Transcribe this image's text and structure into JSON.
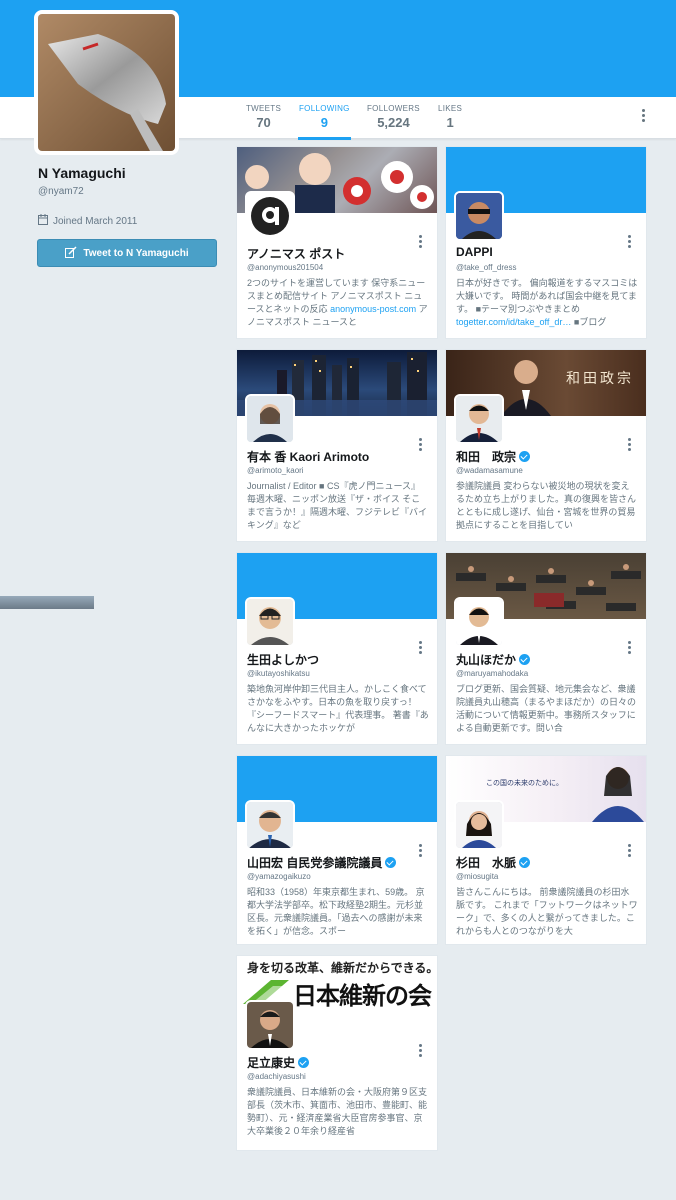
{
  "header": {
    "banner_color": "#1da1f2"
  },
  "nav": {
    "stats": [
      {
        "label": "TWEETS",
        "value": "70"
      },
      {
        "label": "FOLLOWING",
        "value": "9"
      },
      {
        "label": "FOLLOWERS",
        "value": "5,224"
      },
      {
        "label": "LIKES",
        "value": "1"
      }
    ],
    "active_tab": "FOLLOWING"
  },
  "profile": {
    "name": "N Yamaguchi",
    "handle": "@nyam72",
    "joined": "Joined March 2011",
    "tweet_button": "Tweet to N Yamaguchi"
  },
  "cards": [
    {
      "name": "アノニマス ポスト",
      "handle": "@anonymous201504",
      "bio": "2つのサイトを運営しています 保守系ニュースまとめ配信サイト アノニマスポスト ニュースとネットの反応 ",
      "bio_link": "anonymous-post.com",
      "bio_tail": " アノニマスポスト ニュースと",
      "verified": false,
      "avatar_letter": "a"
    },
    {
      "name": "DAPPI",
      "handle": "@take_off_dress",
      "bio": "日本が好きです。 偏向報道をするマスコミは大嫌いです。 時間があれば国会中継を見てます。 ■テーマ別つぶやきまとめ ",
      "bio_link": "togetter.com/id/take_off_dr…",
      "bio_tail": " ■ブログ",
      "verified": false
    },
    {
      "name": "有本 香 Kaori Arimoto",
      "handle": "@arimoto_kaori",
      "bio": "Journalist / Editor ■ CS『虎ノ門ニュース』毎週木曜、ニッポン放送『ザ・ボイス そこまで言うか！』隔週木曜、フジテレビ『バイキング』など",
      "verified": false
    },
    {
      "name": "和田　政宗",
      "handle": "@wadamasamune",
      "bio": "参議院議員 変わらない被災地の現状を変えるため立ち上がりました。真の復興を皆さんとともに成し遂げ、仙台・宮城を世界の貿易拠点にすることを目指してい",
      "verified": true,
      "banner_text": "和田政宗"
    },
    {
      "name": "生田よしかつ",
      "handle": "@ikutayoshikatsu",
      "bio": "築地魚河岸仲卸三代目主人。かしこく食べてさかなをふやす。日本の魚を取り戻すっ！『シーフードスマート』代表理事。 著書『あんなに大きかったホッケが",
      "verified": false
    },
    {
      "name": "丸山ほだか",
      "handle": "@maruyamahodaka",
      "bio": "ブログ更新、国会質疑、地元集会など、衆議院議員丸山穂高（まるやまほだか）の日々の活動について情報更新中。事務所スタッフによる自動更新です。問い合",
      "verified": true
    },
    {
      "name": "山田宏 自民党参議院議員",
      "handle": "@yamazogaikuzo",
      "bio": "昭和33（1958）年東京都生まれ、59歳。 京都大学法学部卒。松下政経塾2期生。元杉並区長。元衆議院議員。「過去への感謝が未来を拓く」が信念。スポー",
      "verified": true
    },
    {
      "name": "杉田　水脈",
      "handle": "@miosugita",
      "bio": "皆さんこんにちは。 前衆議院議員の杉田水脈です。 これまで「フットワークはネットワーク」で、多くの人と繋がってきました。これからも人とのつながりを大",
      "verified": true,
      "banner_text": "この国の未来のために。"
    },
    {
      "name": "足立康史",
      "handle": "@adachiyasushi",
      "bio": "衆議院議員、日本維新の会・大阪府第９区支部長（茨木市、箕面市、池田市、豊能町、能勢町）、元・経済産業省大臣官房参事官、京大卒業後２０年余り経産省",
      "verified": true,
      "banner_slogan": "身を切る改革、維新だからできる。",
      "banner_logo": "日本維新の会"
    }
  ]
}
